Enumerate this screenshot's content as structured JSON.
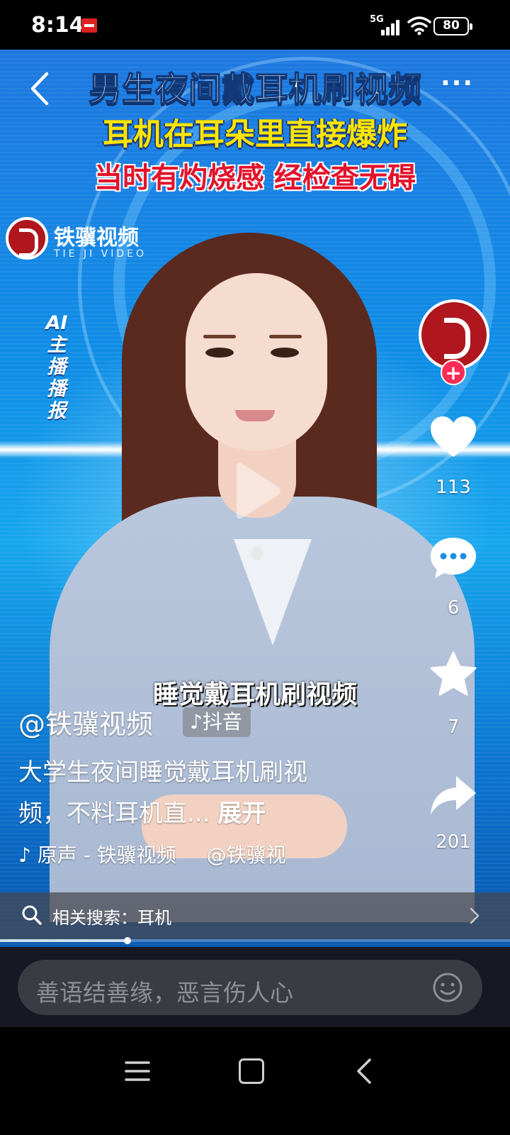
{
  "status_bar": {
    "time": "8:14",
    "network": "5G",
    "battery": "80"
  },
  "video": {
    "headline": [
      "男生夜间戴耳机刷视频",
      "耳机在耳朵里直接爆炸",
      "当时有灼烧感 经检查无碍"
    ],
    "logo": {
      "name": "铁骥视频",
      "subtitle": "TIE JI VIDEO"
    },
    "ai_tag": "AI主播播报",
    "subtitle": "睡觉戴耳机刷视频"
  },
  "actions": {
    "likes": "113",
    "comments": "6",
    "favorites": "7",
    "shares": "201"
  },
  "caption": {
    "author": "@铁骥视频",
    "platform": "抖音",
    "text": "大学生夜间睡觉戴耳机刷视频，不料耳机直...",
    "expand_label": "展开",
    "music": "原声 - 铁骥视频",
    "music_handle": "@铁骥视"
  },
  "related_search": {
    "label": "相关搜索：耳机"
  },
  "progress": 0.25,
  "comment_box": {
    "placeholder": "善语结善缘，恶言伤人心"
  },
  "icons": {
    "back": "back-icon",
    "more": "more-icon",
    "like": "heart-icon",
    "comment": "comment-icon",
    "favorite": "star-icon",
    "share": "share-icon",
    "search": "search-icon",
    "emoji": "emoji-icon",
    "music": "music-note-icon"
  },
  "colors": {
    "follow_accent": "#fe2c55",
    "headline_yellow": "#ffe600",
    "headline_red": "#e3122b"
  }
}
